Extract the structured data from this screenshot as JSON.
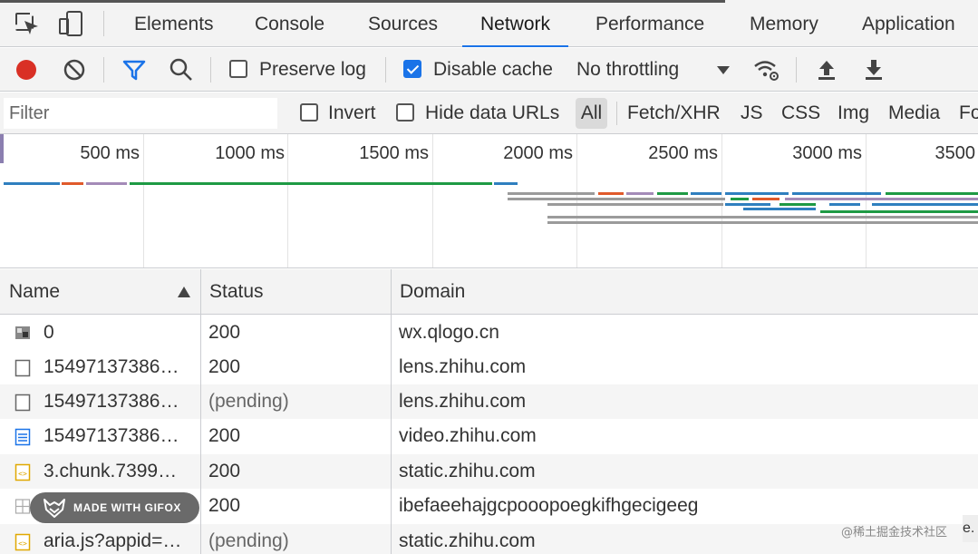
{
  "tabs": [
    {
      "label": "Elements"
    },
    {
      "label": "Console"
    },
    {
      "label": "Sources"
    },
    {
      "label": "Network",
      "active": true
    },
    {
      "label": "Performance"
    },
    {
      "label": "Memory"
    },
    {
      "label": "Application"
    }
  ],
  "toolbar": {
    "preserve_log": {
      "label": "Preserve log",
      "checked": false
    },
    "disable_cache": {
      "label": "Disable cache",
      "checked": true
    },
    "throttling": "No throttling",
    "icons": [
      "record-icon",
      "clear-icon",
      "filter-icon",
      "search-icon",
      "wifi-settings-icon",
      "upload-icon",
      "download-icon"
    ]
  },
  "filter": {
    "placeholder": "Filter",
    "invert_label": "Invert",
    "hide_data_urls_label": "Hide data URLs",
    "types": [
      "All",
      "Fetch/XHR",
      "JS",
      "CSS",
      "Img",
      "Media",
      "Fo"
    ]
  },
  "overview": {
    "ticks": [
      "500 ms",
      "1000 ms",
      "1500 ms",
      "2000 ms",
      "2500 ms",
      "3000 ms",
      "3500"
    ]
  },
  "table": {
    "columns": [
      "Name",
      "Status",
      "Domain"
    ],
    "rows": [
      {
        "icon": "image-icon",
        "name": "0",
        "status": "200",
        "domain": "wx.qlogo.cn"
      },
      {
        "icon": "document-icon",
        "name": "15497137386…",
        "status": "200",
        "domain": "lens.zhihu.com"
      },
      {
        "icon": "document-icon",
        "name": "15497137386…",
        "status": "(pending)",
        "domain": "lens.zhihu.com"
      },
      {
        "icon": "text-file-icon",
        "name": "15497137386…",
        "status": "200",
        "domain": "video.zhihu.com"
      },
      {
        "icon": "script-icon",
        "name": "3.chunk.7399…",
        "status": "200",
        "domain": "static.zhihu.com"
      },
      {
        "icon": "grid-icon",
        "name": "",
        "status": "200",
        "domain": "ibefaeehajgcpooopoegkifhgecigeeg"
      },
      {
        "icon": "script-icon",
        "name": "aria.js?appid=…",
        "status": "(pending)",
        "domain": "static.zhihu.com"
      }
    ]
  },
  "badge": {
    "text": "MADE WITH GIFOX"
  },
  "watermark": {
    "text": "@稀土掘金技术社区",
    "edge": "e."
  },
  "colors": {
    "accent": "#1a73e8",
    "record": "#d93025"
  }
}
